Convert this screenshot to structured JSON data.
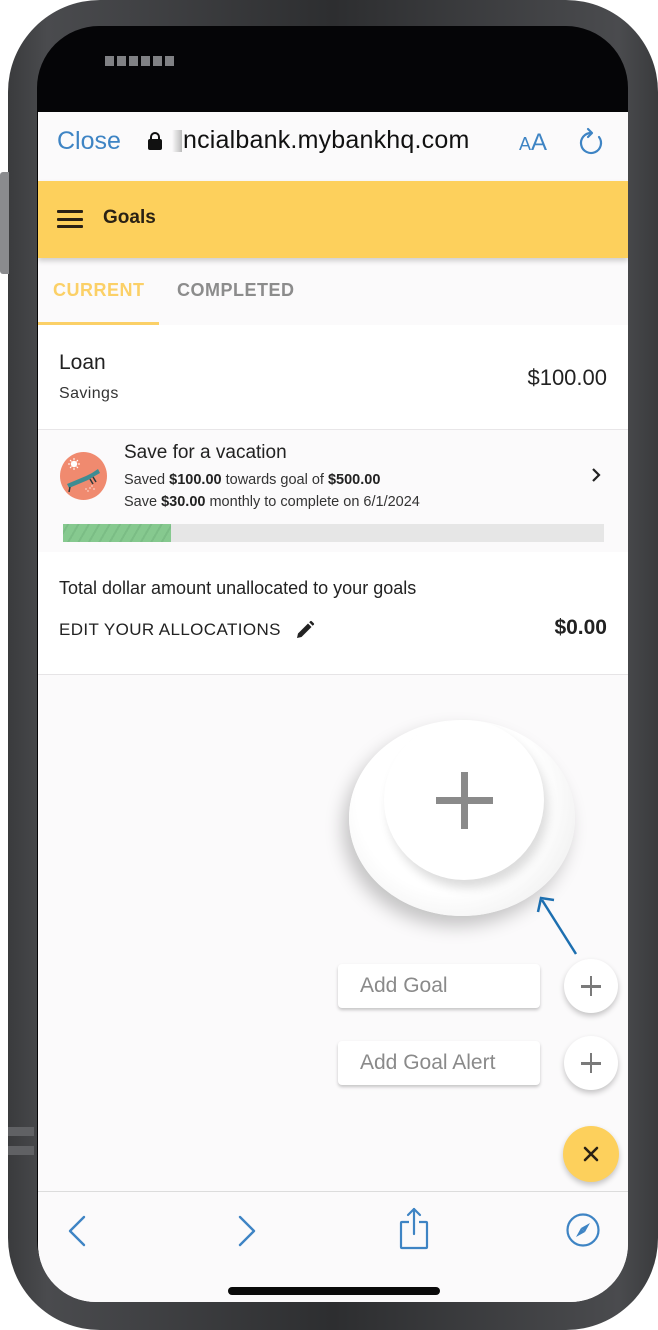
{
  "browser": {
    "close_label": "Close",
    "url": "ncialbank.mybankhq.com",
    "text_size_small": "A",
    "text_size_large": "A",
    "accent_color": "#3e84c4"
  },
  "header": {
    "title": "Goals",
    "background_color": "#fdd05c"
  },
  "tabs": [
    {
      "label": "CURRENT",
      "active": true
    },
    {
      "label": "COMPLETED",
      "active": false
    }
  ],
  "account": {
    "name": "Loan",
    "type": "Savings",
    "amount": "$100.00"
  },
  "goal": {
    "title": "Save for a vacation",
    "line1_prefix": "Saved ",
    "saved_amount": "$100.00",
    "line1_middle": " towards goal of ",
    "goal_amount": "$500.00",
    "line2_prefix": "Save ",
    "monthly_amount": "$30.00",
    "line2_suffix": " monthly to complete on 6/1/2024",
    "progress_fraction": 0.2,
    "icon": "beach-chair-icon"
  },
  "unallocated": {
    "label": "Total dollar amount unallocated to your goals",
    "edit_label": "EDIT YOUR ALLOCATIONS",
    "amount": "$0.00"
  },
  "speed_dial": {
    "actions": [
      {
        "label": "Add Goal",
        "icon": "plus-icon"
      },
      {
        "label": "Add Goal Alert",
        "icon": "plus-icon"
      }
    ],
    "main_icon": "close-icon"
  },
  "toolbar": {
    "icons": [
      "back-icon",
      "forward-icon",
      "share-icon",
      "compass-icon"
    ]
  }
}
